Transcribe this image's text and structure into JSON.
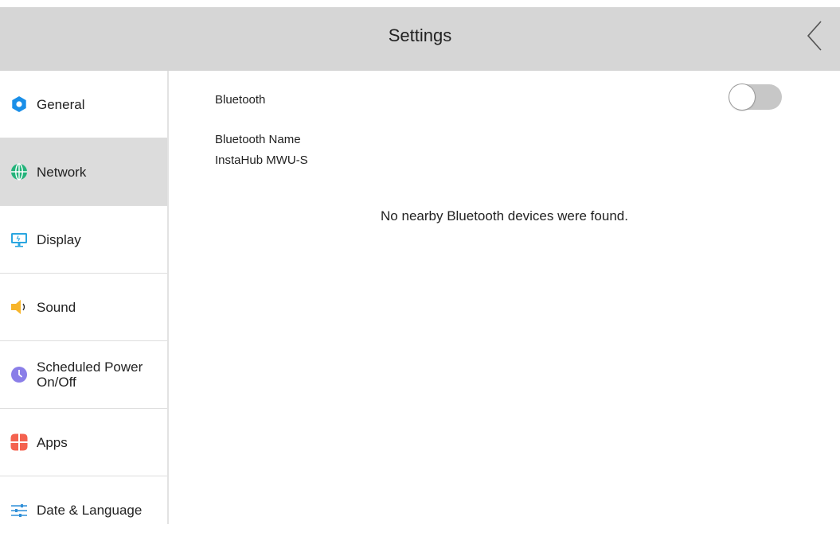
{
  "header": {
    "title": "Settings",
    "back_icon": "chevron-left-icon"
  },
  "sidebar": {
    "items": [
      {
        "label": "General",
        "icon": "gear-icon",
        "icon_color": "#1a8fe8",
        "active": false
      },
      {
        "label": "Network",
        "icon": "globe-icon",
        "icon_color": "#23b37a",
        "active": true
      },
      {
        "label": "Display",
        "icon": "monitor-icon",
        "icon_color": "#2aa6e0",
        "active": false
      },
      {
        "label": "Sound",
        "icon": "speaker-icon",
        "icon_color": "#f7b52b",
        "active": false
      },
      {
        "label": "Scheduled Power On/Off",
        "icon": "clock-icon",
        "icon_color": "#8a7ee8",
        "active": false
      },
      {
        "label": "Apps",
        "icon": "apps-icon",
        "icon_color": "#f4624f",
        "active": false
      },
      {
        "label": "Date & Language",
        "icon": "sliders-icon",
        "icon_color": "#2f8fd8",
        "active": false
      }
    ]
  },
  "bluetooth": {
    "label": "Bluetooth",
    "enabled": false,
    "name_label": "Bluetooth Name",
    "name_value": "InstaHub MWU-S",
    "empty_message": "No nearby Bluetooth devices were found."
  },
  "colors": {
    "header_bg": "#d6d6d6",
    "active_item_bg": "#dcdcdc",
    "toggle_off": "#c7c7c7"
  }
}
